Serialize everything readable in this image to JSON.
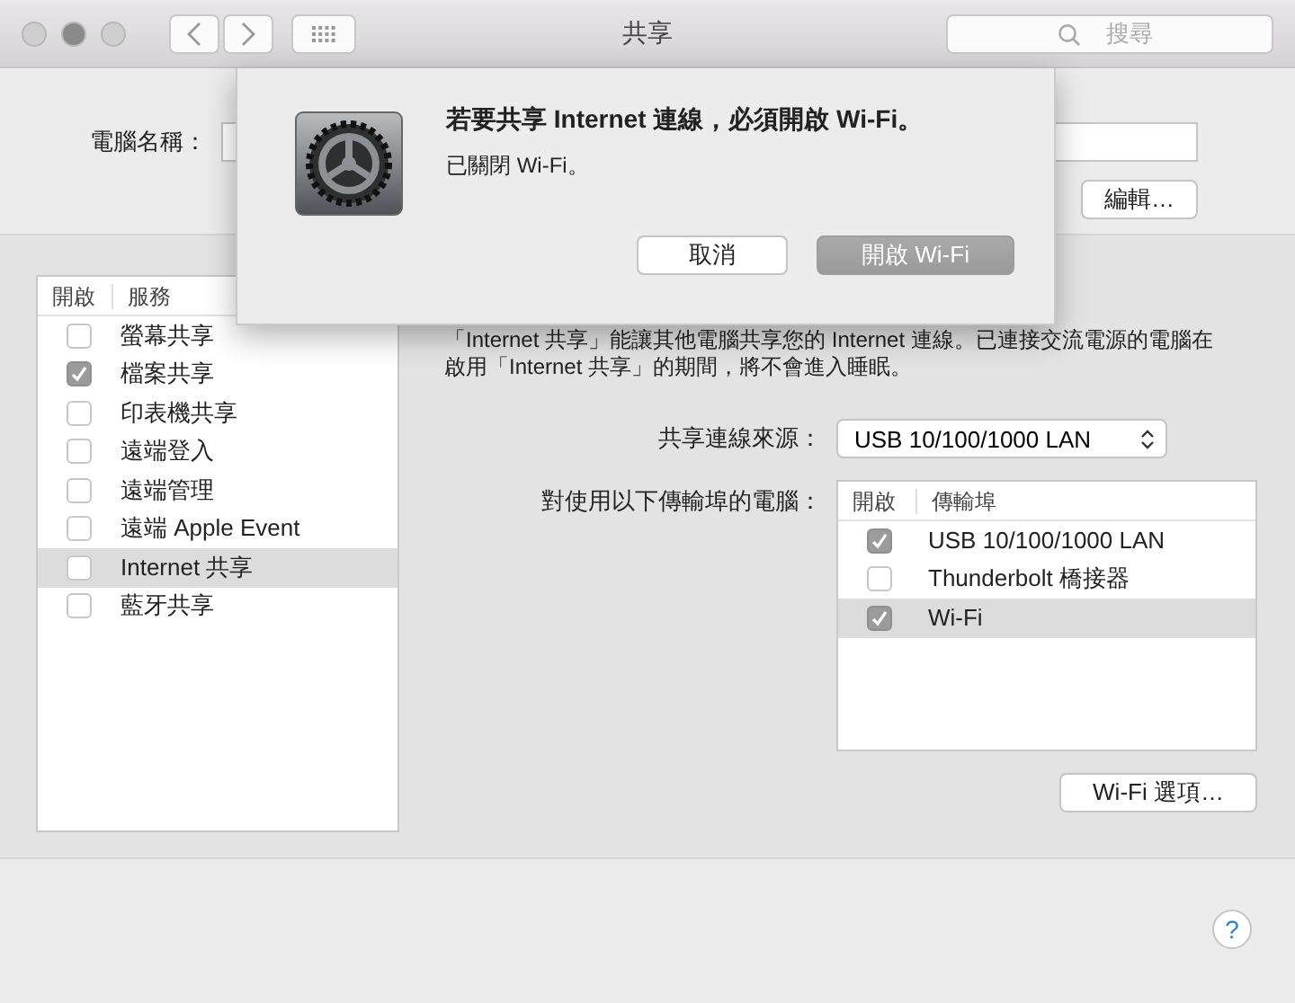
{
  "window": {
    "title": "共享"
  },
  "search": {
    "placeholder": "搜尋"
  },
  "computer_name": {
    "label": "電腦名稱：",
    "edit_button": "編輯…"
  },
  "dialog": {
    "title": "若要共享 Internet 連線，必須開啟 Wi-Fi。",
    "message": "已關閉 Wi-Fi。",
    "buttons": [
      {
        "label": "取消",
        "default": false
      },
      {
        "label": "開啟 Wi-Fi",
        "default": true
      }
    ]
  },
  "services": {
    "columns": [
      "開啟",
      "服務"
    ],
    "items": [
      {
        "name": "螢幕共享",
        "checked": false,
        "selected": false
      },
      {
        "name": "檔案共享",
        "checked": true,
        "selected": false
      },
      {
        "name": "印表機共享",
        "checked": false,
        "selected": false
      },
      {
        "name": "遠端登入",
        "checked": false,
        "selected": false
      },
      {
        "name": "遠端管理",
        "checked": false,
        "selected": false
      },
      {
        "name": "遠端 Apple Event",
        "checked": false,
        "selected": false
      },
      {
        "name": "Internet 共享",
        "checked": false,
        "selected": true
      },
      {
        "name": "藍牙共享",
        "checked": false,
        "selected": false
      }
    ]
  },
  "description": "「Internet 共享」能讓其他電腦共享您的 Internet 連線。已連接交流電源的電腦在啟用「Internet 共享」的期間，將不會進入睡眠。",
  "source": {
    "label": "共享連線來源：",
    "value": "USB 10/100/1000 LAN"
  },
  "ports": {
    "label": "對使用以下傳輸埠的電腦：",
    "columns": [
      "開啟",
      "傳輸埠"
    ],
    "items": [
      {
        "name": "USB 10/100/1000 LAN",
        "checked": true,
        "selected": false
      },
      {
        "name": "Thunderbolt 橋接器",
        "checked": false,
        "selected": false
      },
      {
        "name": "Wi-Fi",
        "checked": true,
        "selected": true
      }
    ]
  },
  "wifi_options_button": "Wi-Fi 選項…",
  "help_button": "?"
}
